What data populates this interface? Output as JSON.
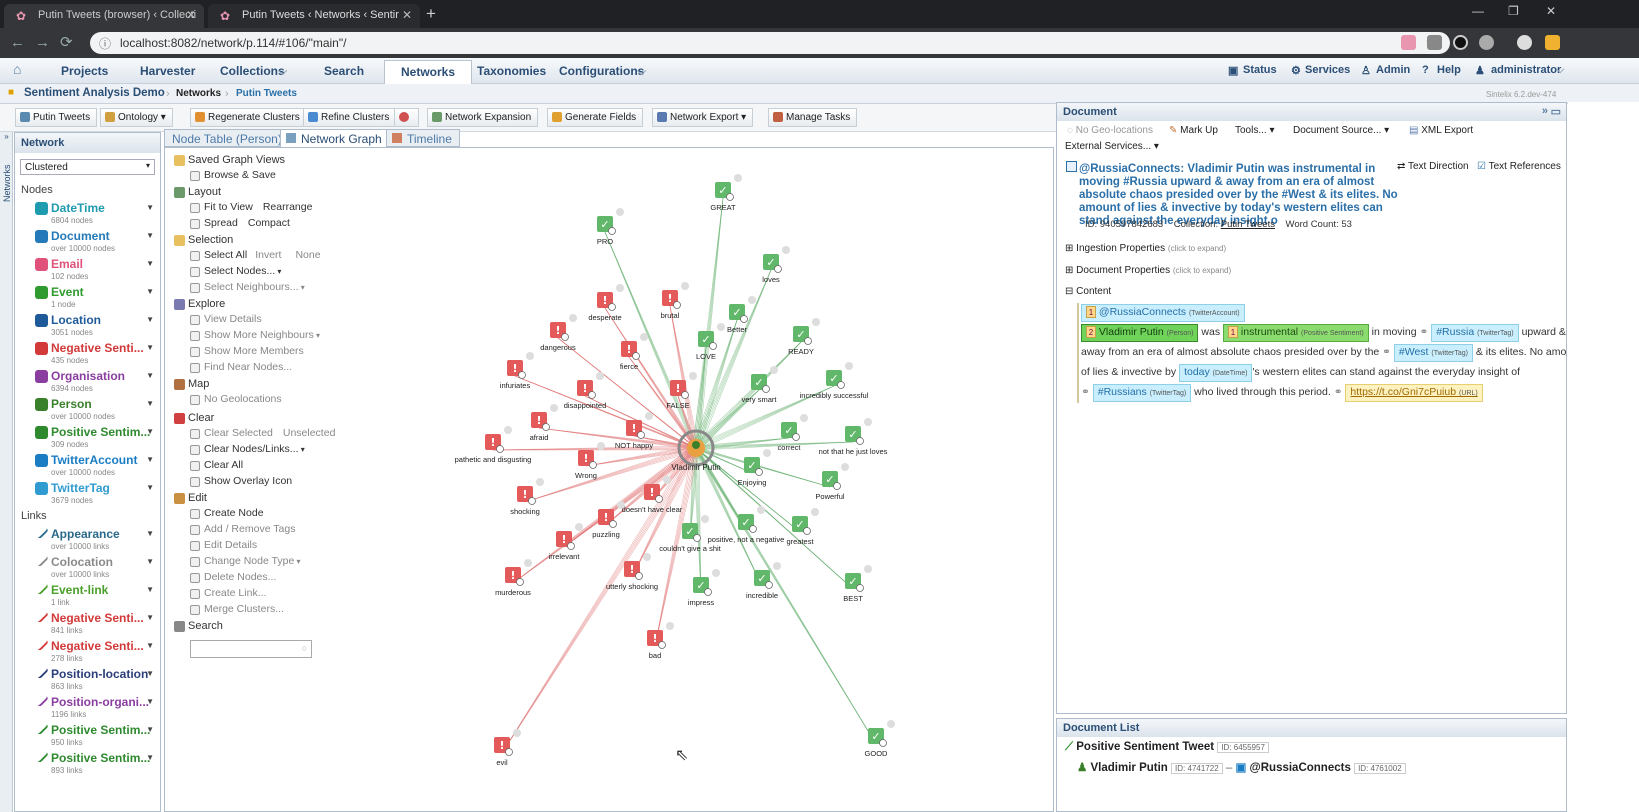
{
  "browser": {
    "tabs": [
      {
        "title": "Putin Tweets (browser) ‹ Collecti"
      },
      {
        "title": "Putin Tweets ‹ Networks ‹ Sentir"
      }
    ],
    "url": "localhost:8082/network/p.114/#106/\"main\"/"
  },
  "appnav": {
    "items": [
      "Projects",
      "Harvester",
      "Collections",
      "Search",
      "Networks",
      "Taxonomies",
      "Configurations"
    ],
    "right": [
      "Status",
      "Services",
      "Admin",
      "Help",
      "administrator"
    ]
  },
  "breadcrumb": {
    "project": "Sentiment Analysis Demo",
    "items": [
      "Networks",
      "Putin Tweets"
    ],
    "version": "Sintelix 6.2.dev-474"
  },
  "toolbar": {
    "buttons": [
      "Putin Tweets",
      "Ontology",
      "Regenerate Clusters",
      "Refine Clusters",
      "Network Expansion",
      "Generate Fields",
      "Network Export",
      "Manage Tasks"
    ]
  },
  "sidestrip_label": "Networks",
  "left": {
    "title": "Network",
    "layout": "Clustered",
    "nodes_label": "Nodes",
    "links_label": "Links",
    "nodes": [
      {
        "name": "DateTime",
        "count": "6804 nodes",
        "color": "#1f9bb0"
      },
      {
        "name": "Document",
        "count": "over 10000 nodes",
        "color": "#2479b8"
      },
      {
        "name": "Email",
        "count": "102 nodes",
        "color": "#e0527a"
      },
      {
        "name": "Event",
        "count": "1 node",
        "color": "#2f9a2f"
      },
      {
        "name": "Location",
        "count": "3051 nodes",
        "color": "#1e5a9a"
      },
      {
        "name": "Negative Senti...",
        "count": "435 nodes",
        "color": "#d23a3a"
      },
      {
        "name": "Organisation",
        "count": "6394 nodes",
        "color": "#8a3fa0"
      },
      {
        "name": "Person",
        "count": "over 10000 nodes",
        "color": "#3a7f2a"
      },
      {
        "name": "Positive Sentim...",
        "count": "309 nodes",
        "color": "#2f8a2f"
      },
      {
        "name": "TwitterAccount",
        "count": "over 10000 nodes",
        "color": "#1a7dc4"
      },
      {
        "name": "TwitterTag",
        "count": "3679 nodes",
        "color": "#2f9bd0"
      }
    ],
    "links": [
      {
        "name": "Appearance",
        "count": "over 10000 links",
        "color": "#2a6a8a"
      },
      {
        "name": "Colocation",
        "count": "over 10000 links",
        "color": "#8a8a8a"
      },
      {
        "name": "Event-link",
        "count": "1 link",
        "color": "#4aa02a"
      },
      {
        "name": "Negative Senti...",
        "count": "841 links",
        "color": "#d23a3a"
      },
      {
        "name": "Negative Senti...",
        "count": "278 links",
        "color": "#d23a3a"
      },
      {
        "name": "Position-location",
        "count": "863 links",
        "color": "#2a3e7a"
      },
      {
        "name": "Position-organi...",
        "count": "1196 links",
        "color": "#8a3fa0"
      },
      {
        "name": "Positive Sentim...",
        "count": "950 links",
        "color": "#2f8a2f"
      },
      {
        "name": "Positive Sentim...",
        "count": "893 links",
        "color": "#2f8a2f"
      }
    ]
  },
  "maintabs": [
    "Node Table (Person)",
    "Network Graph",
    "Timeline"
  ],
  "menu": [
    {
      "head": "Saved Graph Views",
      "color": "#e8c060",
      "rows": [
        {
          "t": "Browse & Save",
          "d": false
        }
      ]
    },
    {
      "head": "Layout",
      "color": "#6a9a6a",
      "rows": [
        {
          "t": "Fit to View",
          "d": false
        },
        {
          "t": "Spread",
          "d": false
        }
      ]
    },
    {
      "head": "Selection",
      "color": "#e8c060",
      "rows": [
        {
          "t": "Select All",
          "d": false
        },
        {
          "t": "Select Nodes...",
          "d": false
        },
        {
          "t": "Select Neighbours...",
          "d": true
        }
      ]
    },
    {
      "head": "Explore",
      "color": "#7a7ab0",
      "rows": [
        {
          "t": "View Details",
          "d": true
        },
        {
          "t": "Show More Neighbours",
          "d": true
        },
        {
          "t": "Show More Members",
          "d": true
        },
        {
          "t": "Find Near Nodes...",
          "d": true
        }
      ]
    },
    {
      "head": "Map",
      "color": "#b07040",
      "rows": [
        {
          "t": "No Geolocations",
          "d": true
        }
      ]
    },
    {
      "head": "Clear",
      "color": "#d04040",
      "rows": [
        {
          "t": "Clear Selected",
          "d": true
        },
        {
          "t": "Clear Nodes/Links...",
          "d": false
        },
        {
          "t": "Clear All",
          "d": false
        },
        {
          "t": "Show Overlay Icon",
          "d": false
        }
      ]
    },
    {
      "head": "Edit",
      "color": "#c89040",
      "rows": [
        {
          "t": "Create Node",
          "d": false
        },
        {
          "t": "Add / Remove Tags",
          "d": true
        },
        {
          "t": "Edit Details",
          "d": true
        },
        {
          "t": "Change Node Type",
          "d": true
        },
        {
          "t": "Delete Nodes...",
          "d": true
        },
        {
          "t": "Create Link...",
          "d": true
        },
        {
          "t": "Merge Clusters...",
          "d": true
        }
      ]
    },
    {
      "head": "Search",
      "color": "#888888",
      "rows": []
    }
  ],
  "menu_extra": {
    "rearrange": "Rearrange",
    "compact": "Compact",
    "invert": "Invert",
    "none": "None",
    "unselected": "Unselected"
  },
  "graph": {
    "center": {
      "label": "Vladimir Putin"
    },
    "nodes": [
      {
        "label": "GREAT",
        "s": "pos"
      },
      {
        "label": "PRO",
        "s": "pos"
      },
      {
        "label": "loves",
        "s": "pos"
      },
      {
        "label": "desperate",
        "s": "neg"
      },
      {
        "label": "brutal",
        "s": "neg"
      },
      {
        "label": "Better",
        "s": "pos"
      },
      {
        "label": "dangerous",
        "s": "neg"
      },
      {
        "label": "fierce",
        "s": "neg"
      },
      {
        "label": "LOVE",
        "s": "pos"
      },
      {
        "label": "READY",
        "s": "pos"
      },
      {
        "label": "infuriates",
        "s": "neg"
      },
      {
        "label": "disappointed",
        "s": "neg"
      },
      {
        "label": "very smart",
        "s": "pos"
      },
      {
        "label": "incredibly successful",
        "s": "pos"
      },
      {
        "label": "FALSE",
        "s": "neg"
      },
      {
        "label": "afraid",
        "s": "neg"
      },
      {
        "label": "NOT happy",
        "s": "neg"
      },
      {
        "label": "correct",
        "s": "pos"
      },
      {
        "label": "not that he just loves",
        "s": "pos"
      },
      {
        "label": "pathetic and disgusting",
        "s": "neg"
      },
      {
        "label": "Wrong",
        "s": "neg"
      },
      {
        "label": "Enjoying",
        "s": "pos"
      },
      {
        "label": "shocking",
        "s": "neg"
      },
      {
        "label": "doesn't have clear",
        "s": "neg"
      },
      {
        "label": "Powerful",
        "s": "pos"
      },
      {
        "label": "puzzling",
        "s": "neg"
      },
      {
        "label": "couldn't give a shit",
        "s": "pos"
      },
      {
        "label": "positive, not a negative",
        "s": "pos"
      },
      {
        "label": "greatest",
        "s": "pos"
      },
      {
        "label": "irrelevant",
        "s": "neg"
      },
      {
        "label": "murderous",
        "s": "neg"
      },
      {
        "label": "utterly shocking",
        "s": "neg"
      },
      {
        "label": "impress",
        "s": "pos"
      },
      {
        "label": "incredible",
        "s": "pos"
      },
      {
        "label": "BEST",
        "s": "pos"
      },
      {
        "label": "bad",
        "s": "neg"
      },
      {
        "label": "evil",
        "s": "neg"
      },
      {
        "label": "GOOD",
        "s": "pos"
      }
    ]
  },
  "doc": {
    "title": "Document",
    "tools": [
      "No Geo-locations",
      "Mark Up",
      "Tools...",
      "Document Source...",
      "XML Export",
      "External Services..."
    ],
    "text_direction": "Text Direction",
    "text_refs": "Text References",
    "heading": "@RussiaConnects: Vladimir Putin was instrumental in moving #Russia upward & away from an era of almost absolute chaos presided over by the #West & its elites. No amount of lies & invective by today's western elites can stand against the everyday insight o",
    "id": "ID: 940597842683",
    "collection_label": "Collection:",
    "collection": "Putin Tweets",
    "wordcount": "Word Count: 53",
    "ingestion": "Ingestion Properties",
    "docprops": "Document Properties",
    "click": "(click to expand)",
    "content": "Content",
    "c": {
      "handle": "@RussiaConnects",
      "handle_t": "(TwitterAccount)",
      "person": "Vladimir Putin",
      "person_t": "(Person)",
      "was": "was",
      "instr": "instrumental",
      "instr_t": "(Positive Sentiment)",
      "moving": "in moving",
      "russia": "#Russia",
      "tag_t": "(TwitterTag)",
      "l2": "upward &",
      "l3a": "away from an era of almost absolute chaos presided over by the",
      "west": "#West",
      "l3b": "& its elites. No amount",
      "l4a": "of lies & invective by",
      "today": "today",
      "today_t": "(DateTime)",
      "l4b": "'s western elites can stand against the everyday insight of",
      "russians": "#Russians",
      "l5": "who lived through this period.",
      "url": "https://t.co/Gni7cPuiub",
      "url_t": "(URL)"
    }
  },
  "doclist": {
    "title": "Document List",
    "r1": "Positive Sentiment Tweet",
    "r1id": "ID: 6455957",
    "r2a": "Vladimir Putin",
    "r2aid": "ID: 4741722",
    "r2b": "@RussiaConnects",
    "r2bid": "ID: 4761002"
  }
}
